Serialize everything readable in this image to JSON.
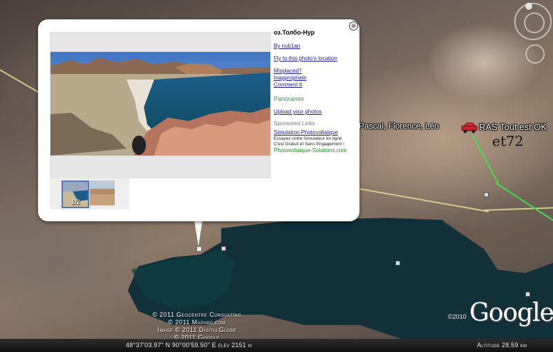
{
  "map": {
    "labels": {
      "names": "Pascal, Florence, Léo",
      "status": "RAS Tout est OK",
      "handwritten": "et72"
    },
    "credits": [
      "© 2011 Geocentre Consulting",
      "© 2011 Mapabc.com",
      "Image © 2011 DigitalGlobe",
      "© 2011 Google"
    ],
    "google_logo": "Google",
    "copyright_year": "©2010",
    "status_bar": {
      "coordinates": "48°37'03.97\" N 90°00'59.50\" E élév 2151 m",
      "altitude": "Altitude 28.59 km"
    }
  },
  "balloon": {
    "close_symbol": "⊗",
    "title": "оз.Толбо-Нур",
    "author": "By nub1an",
    "fly_to": "Fly to this photo's location",
    "misplaced": "Misplaced?",
    "inappropriate": "Inappropriate",
    "comment": "Comment it",
    "panoramio": {
      "pre": "Pan",
      "o": "o",
      "post": "ramio"
    },
    "upload": "Upload your photos",
    "sponsored_label": "Sponsored Links",
    "ad": {
      "title": "Simulation Photovoltaïque",
      "line1": "Essayez notre Simulateur en ligne",
      "line2": "C'est Gratuit et Sans Engagement !",
      "url": "Photovoltaique-Solutions.com"
    },
    "thumb_count": "1/2"
  },
  "colors": {
    "link": "#1a1aa6",
    "panoramio_green": "#2b9e3c",
    "track_green": "#3fe04a",
    "road": "#d9c98a"
  }
}
